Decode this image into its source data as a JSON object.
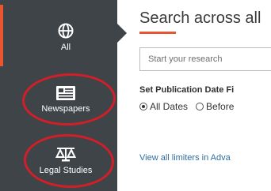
{
  "sidebar": {
    "items": [
      {
        "label": "All",
        "icon": "globe-icon"
      },
      {
        "label": "Newspapers",
        "icon": "newspaper-icon"
      },
      {
        "label": "Legal Studies",
        "icon": "scales-icon"
      }
    ]
  },
  "main": {
    "title": "Search across all",
    "search": {
      "placeholder": "Start your research"
    },
    "filter_heading": "Set Publication Date Fi",
    "date_options": [
      {
        "label": "All Dates",
        "selected": true
      },
      {
        "label": "Before",
        "selected": false
      }
    ],
    "advanced_link": "View all limiters in Adva"
  },
  "colors": {
    "sidebar_bg": "#3f4448",
    "accent": "#e8552f",
    "annotation_circle": "#d11f2a",
    "link": "#2e6da4"
  }
}
